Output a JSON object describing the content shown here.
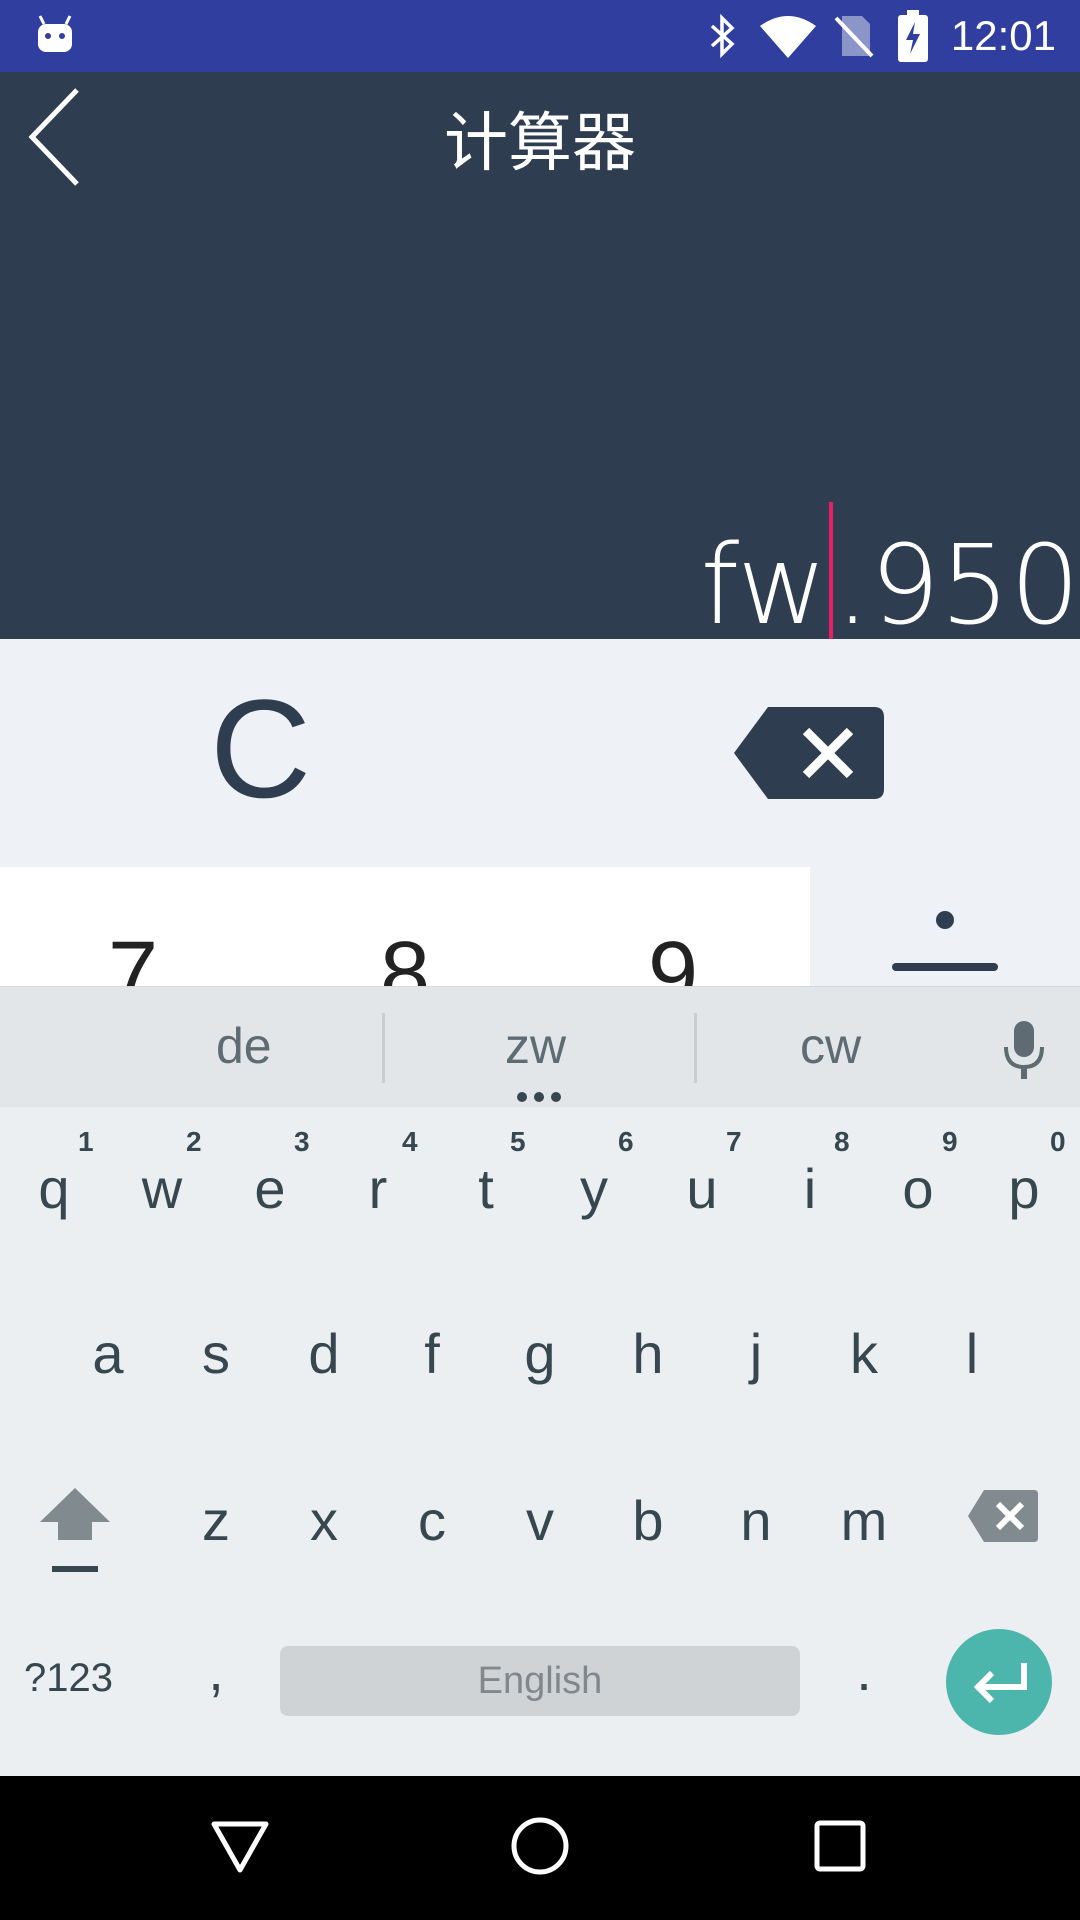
{
  "status_bar": {
    "time": "12:01"
  },
  "app": {
    "title": "计算器",
    "display": {
      "composing": "fw",
      "rest": ".950"
    }
  },
  "calculator": {
    "clear_label": "C",
    "visible_digits": [
      "7",
      "8",
      "9"
    ]
  },
  "keyboard": {
    "suggestions": [
      "de",
      "zw",
      "cw"
    ],
    "row1": [
      {
        "key": "q",
        "hint": "1"
      },
      {
        "key": "w",
        "hint": "2"
      },
      {
        "key": "e",
        "hint": "3"
      },
      {
        "key": "r",
        "hint": "4"
      },
      {
        "key": "t",
        "hint": "5"
      },
      {
        "key": "y",
        "hint": "6"
      },
      {
        "key": "u",
        "hint": "7"
      },
      {
        "key": "i",
        "hint": "8"
      },
      {
        "key": "o",
        "hint": "9"
      },
      {
        "key": "p",
        "hint": "0"
      }
    ],
    "row2": [
      "a",
      "s",
      "d",
      "f",
      "g",
      "h",
      "j",
      "k",
      "l"
    ],
    "row3": [
      "z",
      "x",
      "c",
      "v",
      "b",
      "n",
      "m"
    ],
    "symbols_label": "?123",
    "comma": ",",
    "space_label": "English",
    "period": "."
  },
  "colors": {
    "status_bar": "#303f9f",
    "header": "#2f3d50",
    "caret": "#e91e63",
    "enter": "#4db6ac"
  }
}
